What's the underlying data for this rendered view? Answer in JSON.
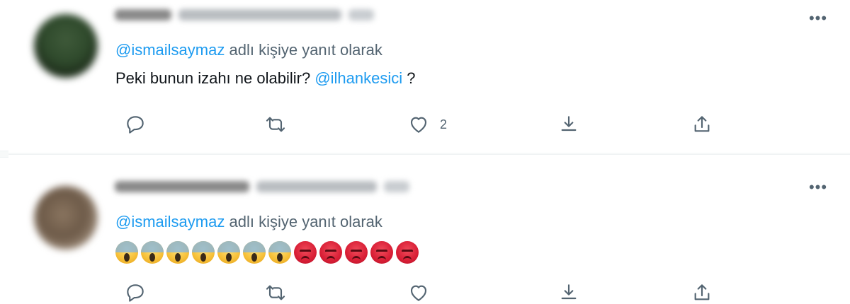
{
  "tweets": [
    {
      "reply_prefix": "adlı kişiye yanıt olarak",
      "reply_to": "@ismailsaymaz",
      "text_before": "Peki bunun izahı ne olabilir?",
      "mention": "@ilhankesici",
      "text_after": " ?",
      "like_count": "2",
      "more_label": "•••"
    },
    {
      "reply_prefix": "adlı kişiye yanıt olarak",
      "reply_to": "@ismailsaymaz",
      "emojis": [
        "scream",
        "scream",
        "scream",
        "scream",
        "scream",
        "scream",
        "scream",
        "angry",
        "angry",
        "angry",
        "angry",
        "angry"
      ],
      "like_count": "",
      "more_label": "•••"
    }
  ],
  "colors": {
    "mention": "#1d9bf0",
    "secondary_text": "#536471",
    "primary_text": "#0f1419"
  },
  "icons": [
    "reply-icon",
    "retweet-icon",
    "like-icon",
    "share-icon",
    "upload-icon",
    "more-icon"
  ]
}
